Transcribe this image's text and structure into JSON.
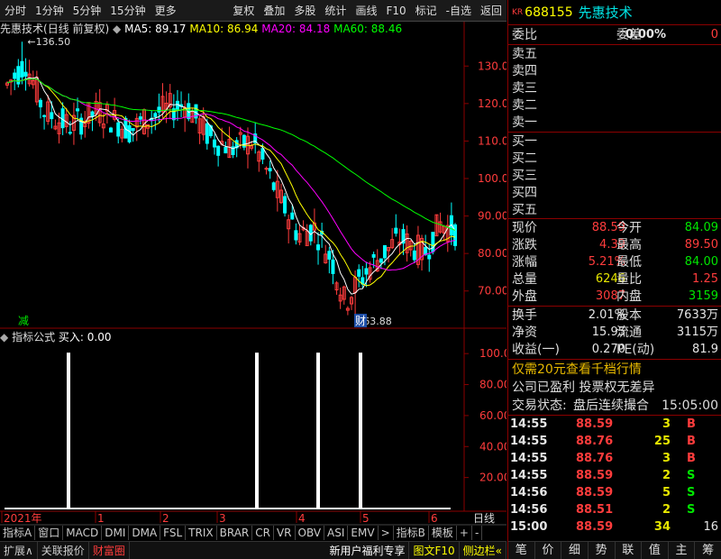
{
  "toolbar": {
    "items": [
      "分时",
      "1分钟",
      "5分钟",
      "15分钟",
      "更多",
      "复权",
      "叠加",
      "多股",
      "统计",
      "画线",
      "F10",
      "标记",
      "-自选",
      "返回"
    ]
  },
  "chart": {
    "stock_label": "先惠技术",
    "fq_label": "(日线 前复权)",
    "ma5": "MA5: 89.17",
    "ma10": "MA10: 86.94",
    "ma20": "MA20: 84.18",
    "ma60": "MA60: 88.46",
    "high_label": "136.50",
    "low_label": "63.88",
    "reduce_mark": "减",
    "cai_mark": "财",
    "price_ticks": [
      "130.0",
      "120.0",
      "110.0",
      "100.0",
      "90.00",
      "80.00",
      "70.00"
    ],
    "ind_ticks": [
      "100.0",
      "80.00",
      "60.00",
      "40.00",
      "20.00"
    ],
    "ind_title": "指标公式",
    "ind_value": "买入: 0.00",
    "x_labels": [
      "2021年",
      "1",
      "2",
      "3",
      "4",
      "5",
      "6"
    ],
    "x_right": "日线",
    "colors": {
      "up": "#ff3c3c",
      "down": "#00ffff",
      "ma5": "#ffffff",
      "ma10": "#ffff00",
      "ma20": "#ff00ff",
      "ma60": "#00ff00"
    }
  },
  "chart_data": {
    "type": "candlestick",
    "title": "先惠技术 (日线 前复权)",
    "ylim": [
      62,
      138
    ],
    "x_labels": [
      "2021年",
      "1",
      "2",
      "3",
      "4",
      "5",
      "6"
    ],
    "annotations": {
      "high": 136.5,
      "low": 63.88
    },
    "indicator": {
      "name": "买入",
      "current": 0.0,
      "ylim": [
        0,
        110
      ],
      "peaks": [
        100,
        100,
        100,
        100
      ]
    }
  },
  "tabs_row1": [
    "指标A",
    "窗口",
    "MACD",
    "DMI",
    "DMA",
    "FSL",
    "TRIX",
    "BRAR",
    "CR",
    "VR",
    "OBV",
    "ASI",
    "EMV",
    ">",
    "指标B",
    "模板",
    "+",
    "-"
  ],
  "tabs_row2": [
    "扩展∧",
    "关联报价",
    "财富圈",
    "新用户福利专享",
    "图文F10",
    "侧边栏«"
  ],
  "quote": {
    "market": "KR",
    "code": "688155",
    "name": "先惠技术",
    "weibi_label": "委比",
    "weibi": "0.00%",
    "weicha_label": "委差",
    "weicha": "0",
    "sell": [
      "卖五",
      "卖四",
      "卖三",
      "卖二",
      "卖一"
    ],
    "buy": [
      "买一",
      "买二",
      "买三",
      "买四",
      "买五"
    ],
    "stats": [
      {
        "l": "现价",
        "v": "88.59",
        "vc": "red",
        "l2": "今开",
        "v2": "84.09",
        "v2c": "green"
      },
      {
        "l": "涨跌",
        "v": "4.39",
        "vc": "red",
        "l2": "最高",
        "v2": "89.50",
        "v2c": "red"
      },
      {
        "l": "涨幅",
        "v": "5.21%",
        "vc": "red",
        "l2": "最低",
        "v2": "84.00",
        "v2c": "green"
      },
      {
        "l": "总量",
        "v": "6246",
        "vc": "yellow",
        "l2": "量比",
        "v2": "1.25",
        "v2c": "red"
      },
      {
        "l": "外盘",
        "v": "3087",
        "vc": "red",
        "l2": "内盘",
        "v2": "3159",
        "v2c": "green"
      }
    ],
    "stats2": [
      {
        "l": "换手",
        "v": "2.01%",
        "l2": "股本",
        "v2": "7633万"
      },
      {
        "l": "净资",
        "v": "15.95",
        "l2": "流通",
        "v2": "3115万"
      },
      {
        "l": "收益(一)",
        "v": "0.270",
        "l2": "PE(动)",
        "v2": "81.9"
      }
    ],
    "promo": "仅需20元查看千档行情",
    "notice": "公司已盈利 投票权无差异",
    "status_label": "交易状态:",
    "status": "盘后连续撮合",
    "status_time": "15:05:00",
    "ticks": [
      {
        "t": "14:55",
        "p": "88.59",
        "v": "3",
        "bs": "B"
      },
      {
        "t": "14:55",
        "p": "88.76",
        "v": "25",
        "bs": "B"
      },
      {
        "t": "14:55",
        "p": "88.76",
        "v": "3",
        "bs": "B"
      },
      {
        "t": "14:55",
        "p": "88.59",
        "v": "2",
        "bs": "S"
      },
      {
        "t": "14:56",
        "p": "88.59",
        "v": "5",
        "bs": "S"
      },
      {
        "t": "14:56",
        "p": "88.51",
        "v": "2",
        "bs": "S"
      },
      {
        "t": "15:00",
        "p": "88.59",
        "v": "34",
        "bs": "",
        "n": "16"
      }
    ],
    "tabs": [
      "笔",
      "价",
      "细",
      "势",
      "联",
      "值",
      "主",
      "筹"
    ]
  }
}
